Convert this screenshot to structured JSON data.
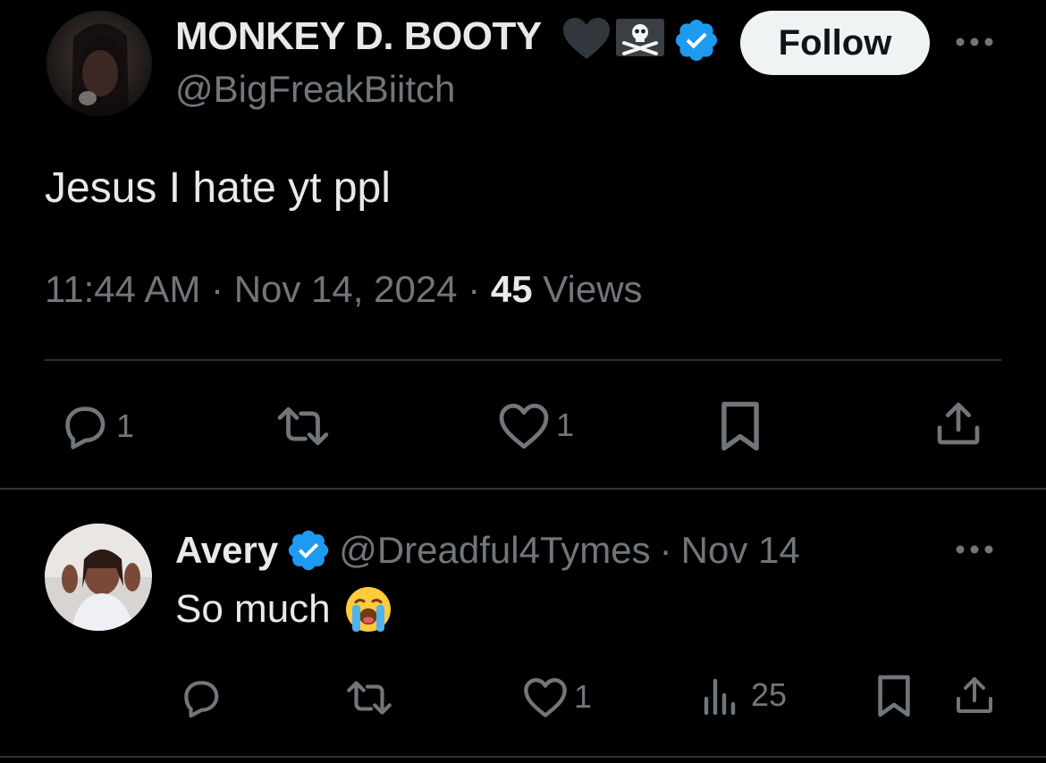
{
  "tweet": {
    "author": {
      "display_name": "MONKEY D. BOOTY",
      "handle": "@BigFreakBiitch",
      "badges": [
        "black-heart-icon",
        "skull-crossbones-icon",
        "verified-badge-icon"
      ]
    },
    "follow_label": "Follow",
    "text": "Jesus I hate yt ppl",
    "time": "11:44 AM",
    "separator": "·",
    "date": "Nov 14, 2024",
    "views_count": "45",
    "views_label": "Views",
    "actions": {
      "reply_count": "1",
      "retweet_count": "",
      "like_count": "1"
    }
  },
  "reply": {
    "author": {
      "display_name": "Avery",
      "handle": "@Dreadful4Tymes",
      "date": "Nov 14"
    },
    "separator": "·",
    "text": "So much",
    "emoji": "loudly-crying-face-icon",
    "actions": {
      "like_count": "1",
      "views_count": "25"
    }
  },
  "colors": {
    "background": "#000000",
    "text_primary": "#e7e9ea",
    "text_muted": "#71767b",
    "verified_blue": "#1d9bf0",
    "divider": "#2f3336",
    "follow_bg": "#eff3f4"
  }
}
